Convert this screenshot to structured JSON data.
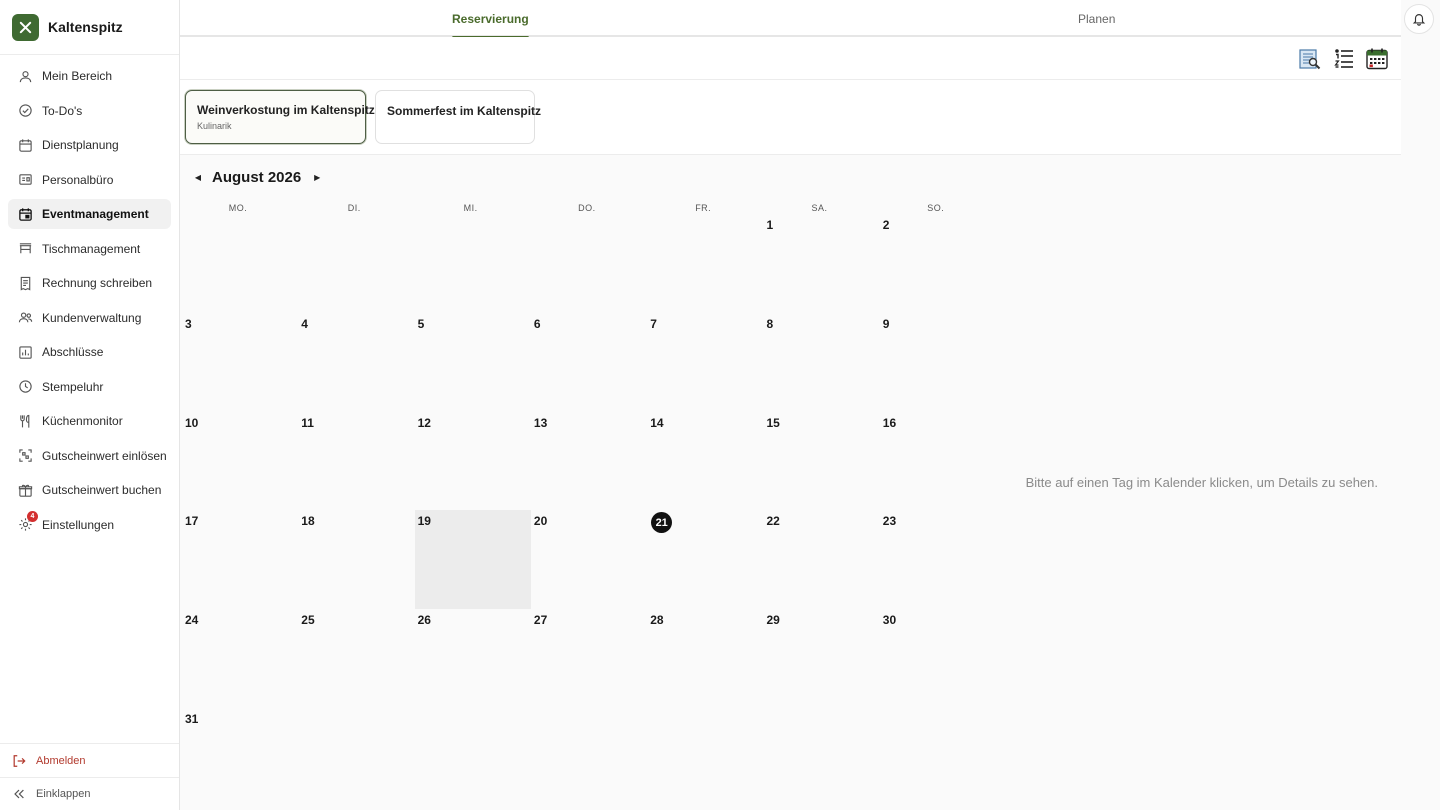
{
  "app": {
    "name": "Kaltenspitz"
  },
  "sidebar": {
    "items": [
      {
        "label": "Mein Bereich",
        "icon": "user-icon"
      },
      {
        "label": "To-Do's",
        "icon": "check-circle-icon"
      },
      {
        "label": "Dienstplanung",
        "icon": "calendar-icon"
      },
      {
        "label": "Personalbüro",
        "icon": "id-card-icon"
      },
      {
        "label": "Eventmanagement",
        "icon": "calendar-event-icon",
        "active": true
      },
      {
        "label": "Tischmanagement",
        "icon": "table-icon"
      },
      {
        "label": "Rechnung schreiben",
        "icon": "receipt-icon"
      },
      {
        "label": "Kundenverwaltung",
        "icon": "users-icon"
      },
      {
        "label": "Abschlüsse",
        "icon": "bar-chart-icon"
      },
      {
        "label": "Stempeluhr",
        "icon": "clock-icon"
      },
      {
        "label": "Küchenmonitor",
        "icon": "cutlery-icon"
      },
      {
        "label": "Gutscheinwert einlösen",
        "icon": "scan-icon"
      },
      {
        "label": "Gutscheinwert buchen",
        "icon": "gift-icon"
      },
      {
        "label": "Einstellungen",
        "icon": "gear-icon",
        "badge": "4"
      }
    ],
    "logout_label": "Abmelden",
    "collapse_label": "Einklappen"
  },
  "tabs": {
    "reservation": "Reservierung",
    "planning": "Planen"
  },
  "events": [
    {
      "title": "Weinverkostung im Kaltenspitz",
      "subtitle": "Kulinarik",
      "selected": true
    },
    {
      "title": "Sommerfest im Kaltenspitz",
      "subtitle": ""
    }
  ],
  "calendar": {
    "month_label": "August 2026",
    "weekdays": [
      "MO.",
      "DI.",
      "MI.",
      "DO.",
      "FR.",
      "SA.",
      "SO."
    ],
    "days": [
      "1",
      "2",
      "3",
      "4",
      "5",
      "6",
      "7",
      "8",
      "9",
      "10",
      "11",
      "12",
      "13",
      "14",
      "15",
      "16",
      "17",
      "18",
      "19",
      "20",
      "21",
      "22",
      "23",
      "24",
      "25",
      "26",
      "27",
      "28",
      "29",
      "30",
      "31"
    ],
    "today": "21",
    "hovered": "19"
  },
  "hint": "Bitte auf einen Tag im Kalender klicken, um Details zu sehen.",
  "colors": {
    "brand": "#3f6a32",
    "accent": "#4a6b2c",
    "danger": "#d32f2f"
  }
}
